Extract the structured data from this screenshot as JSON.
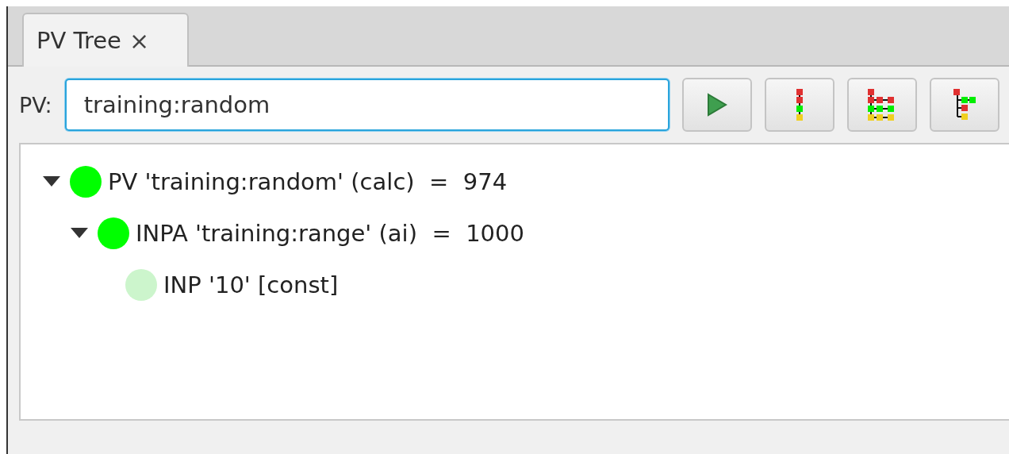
{
  "tab": {
    "label": "PV Tree",
    "close": "×",
    "selected": true
  },
  "pv_field": {
    "label": "PV:",
    "value": "training:random",
    "focused": true
  },
  "toolbar_buttons": [
    {
      "kind": "run"
    },
    {
      "kind": "chain"
    },
    {
      "kind": "grid"
    },
    {
      "kind": "tree"
    }
  ],
  "tree": [
    {
      "label": "PV 'training:random' (calc)  =  974",
      "color": "#00ff00",
      "expanded": true,
      "children": [
        {
          "label": "INPA 'training:range' (ai)  =  1000",
          "color": "#00ff00",
          "expanded": true,
          "children": [
            {
              "label": "INP '10' [const]",
              "color": "#ccf5cc"
            }
          ]
        }
      ]
    }
  ]
}
